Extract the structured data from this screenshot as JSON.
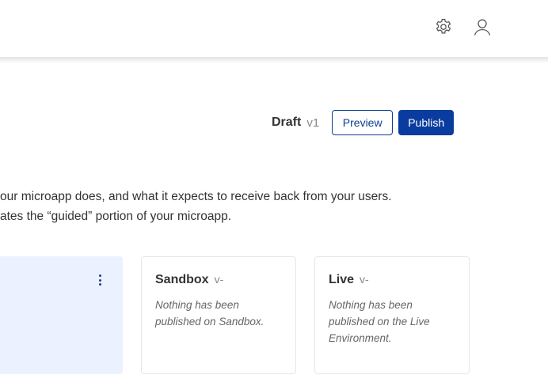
{
  "header": {
    "settings_icon": "gear-icon",
    "user_icon": "user-icon"
  },
  "version_bar": {
    "status_label": "Draft",
    "version": "v1",
    "preview_label": "Preview",
    "publish_label": "Publish"
  },
  "description": {
    "line1": "our microapp does, and what it expects to receive back from your users.",
    "line2": "ates the “guided” portion of your microapp."
  },
  "environments": [
    {
      "name": "Sandbox",
      "version": "v-",
      "message": "Nothing has been published on Sandbox."
    },
    {
      "name": "Live",
      "version": "v-",
      "message": "Nothing has been published on the Live Environment."
    }
  ],
  "colors": {
    "primary": "#0a3c9f",
    "draft_card_bg": "#ebf1fe",
    "muted_text": "#888888"
  }
}
